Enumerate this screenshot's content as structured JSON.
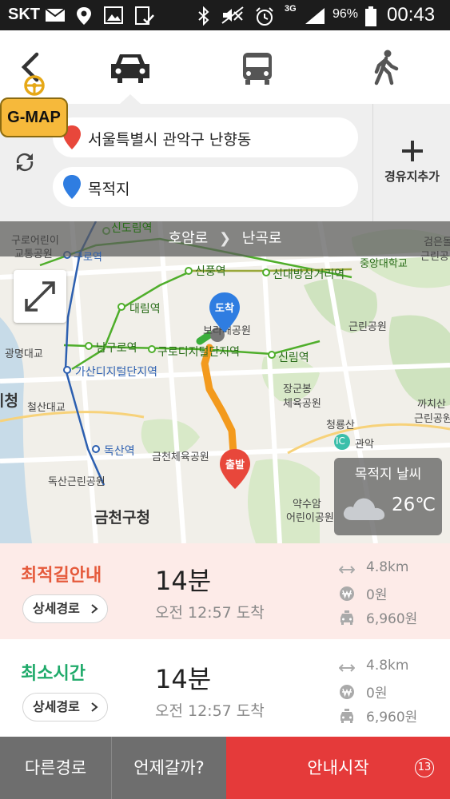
{
  "status_bar": {
    "carrier": "SKT",
    "battery": "96%",
    "time": "00:43",
    "network": "3G"
  },
  "modes": {
    "items": [
      {
        "icon": "car-icon",
        "selected": true
      },
      {
        "icon": "bus-icon",
        "selected": false
      },
      {
        "icon": "walk-icon",
        "selected": false
      }
    ]
  },
  "badge": {
    "label": "G-MAP"
  },
  "search": {
    "origin": "서울특별시 관악구 난향동",
    "destination": "목적지",
    "add_waypoint": "경유지추가"
  },
  "map": {
    "current_road": "호암로",
    "next_road": "난곡로",
    "end_marker": "도착",
    "start_marker": "출발",
    "labels": {
      "sindorim": "신도림역",
      "guro_kids": "구로어린이",
      "guro_kids2": "교통공원",
      "guro": "구로역",
      "sinpung": "신풍역",
      "sindaebang": "신대방삼거리역",
      "chungang": "중앙대학교",
      "geoneun": "검은돌",
      "geunlin_tr": "근린공",
      "daerim": "대림역",
      "boramae": "보라매공원",
      "geunlin": "근린공원",
      "gwangmyeong": "광명대교",
      "namguro": "남구로역",
      "guro_digital": "구로디지털단지역",
      "sillim": "신림역",
      "gasan": "가산디지털단지역",
      "janggunbong": "장군봉",
      "sports": "체육공원",
      "cheong": "시청",
      "cheolsan": "철산대교",
      "kkachisan": "까치산",
      "kkachi_park": "근린공원",
      "cheongryong": "청룡산",
      "ic": "IC",
      "gwanak": "관악",
      "doksan": "독산역",
      "geumcheon_sports": "금천체육공원",
      "doksan_park": "독산근린공원",
      "yaksuam": "약수암",
      "kids_park": "어린이공원",
      "geumcheon_office": "금천구청"
    },
    "weather": {
      "title": "목적지 날씨",
      "temp": "26℃"
    }
  },
  "routes": [
    {
      "name": "최적길안내",
      "detail": "상세경로",
      "duration": "14분",
      "arrival": "오전 12:57 도착",
      "distance": "4.8km",
      "toll": "0원",
      "taxi": "6,960원"
    },
    {
      "name": "최소시간",
      "detail": "상세경로",
      "duration": "14분",
      "arrival": "오전 12:57 도착",
      "distance": "4.8km",
      "toll": "0원",
      "taxi": "6,960원"
    }
  ],
  "bottom": {
    "other_route": "다른경로",
    "when": "언제갈까?",
    "start": "안내시작",
    "countdown": "13"
  },
  "colors": {
    "accent_red": "#e53a3a",
    "best_route": "#e55a3c",
    "fastest_route": "#1faa6a",
    "route_line": "#f39a1d"
  }
}
